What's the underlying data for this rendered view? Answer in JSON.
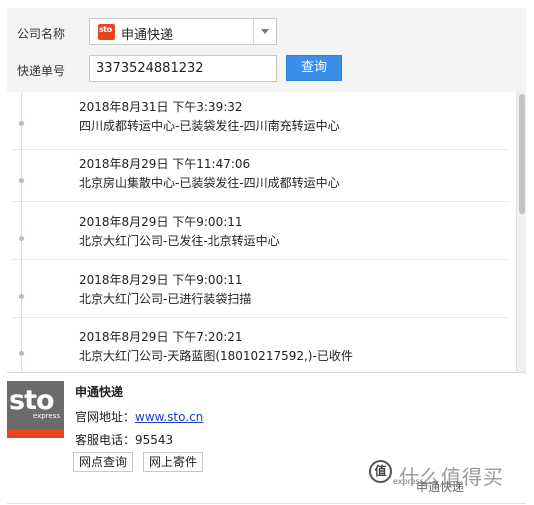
{
  "query": {
    "company_label": "公司名称",
    "company_logo_text": "sto",
    "company_value": "申通快递",
    "tracking_label": "快递单号",
    "tracking_value": "3373524881232",
    "query_button": "查询"
  },
  "timeline": [
    {
      "time": "2018年8月31日 下午3:39:32",
      "desc": "四川成都转运中心-已装袋发往-四川南充转运中心"
    },
    {
      "time": "2018年8月29日 下午11:47:06",
      "desc": "北京房山集散中心-已装袋发往-四川成都转运中心"
    },
    {
      "time": "2018年8月29日 下午9:00:11",
      "desc": "北京大红门公司-已发往-北京转运中心"
    },
    {
      "time": "2018年8月29日 下午9:00:11",
      "desc": "北京大红门公司-已进行装袋扫描"
    },
    {
      "time": "2018年8月29日 下午7:20:21",
      "desc": "北京大红门公司-天路蓝图(18010217592,)-已收件"
    }
  ],
  "company_info": {
    "logo_main": "sto",
    "logo_sub": "express",
    "name": "申通快递",
    "website_label": "官网地址：",
    "website_url": "www.sto.cn",
    "phone_label": "客服电话：",
    "phone": "95543",
    "outlet_button": "网点查询",
    "online_button": "网上寄件"
  },
  "watermark": {
    "mark": "值",
    "text": "什么值得买",
    "sub": "express",
    "overlay": "申通快递"
  },
  "colors": {
    "accent": "#3b8ee8",
    "brand": "#e8451f",
    "dot": "#a9bfd9"
  }
}
